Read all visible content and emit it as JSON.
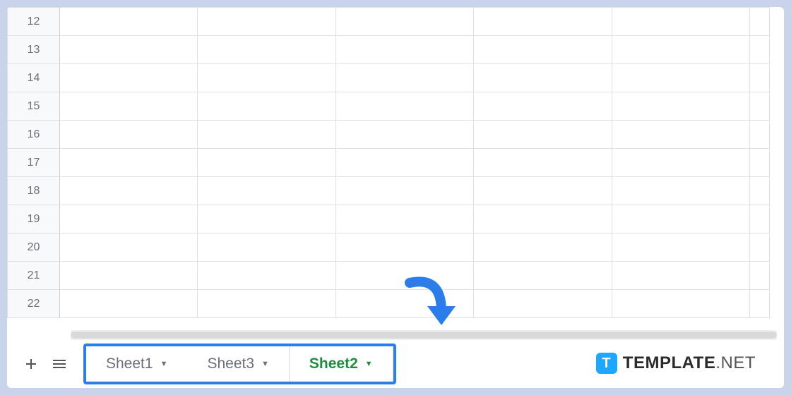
{
  "rows": [
    "12",
    "13",
    "14",
    "15",
    "16",
    "17",
    "18",
    "19",
    "20",
    "21",
    "22"
  ],
  "tabs": {
    "sheet1": "Sheet1",
    "sheet3": "Sheet3",
    "sheet2": "Sheet2"
  },
  "watermark": {
    "bold": "TEMPLATE",
    "light": ".NET",
    "logo": "T"
  }
}
